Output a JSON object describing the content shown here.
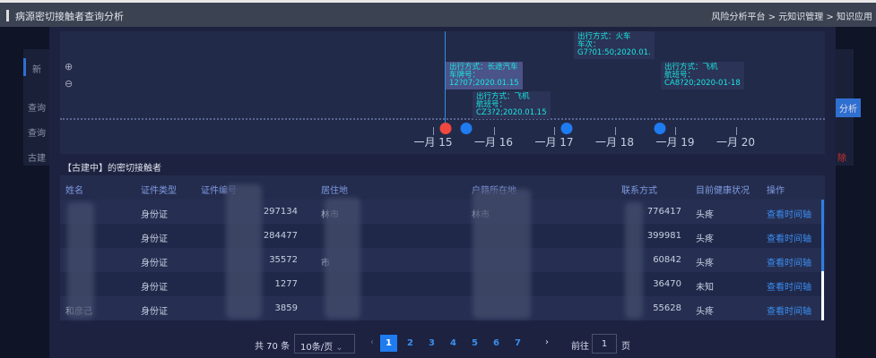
{
  "header": {
    "title": "病源密切接触者查询分析",
    "breadcrumb": "风险分析平台 > 元知识管理 > 知识应用"
  },
  "background": {
    "tab": "新",
    "query_label": "查询",
    "input_placeholder": "查询",
    "row_text": "古建",
    "analyze_button": "分析",
    "delete_text": "除"
  },
  "timeline": {
    "zoom_in": "⊕",
    "zoom_out": "⊖",
    "ticks": [
      "一月 15",
      "一月 16",
      "一月 17",
      "一月 18",
      "一月 19",
      "一月 20"
    ],
    "points": [
      {
        "color": "#f0483e",
        "day": 15.2
      },
      {
        "color": "#1e7bf0",
        "day": 15.55
      },
      {
        "color": "#1e7bf0",
        "day": 17.2
      },
      {
        "color": "#1e7bf0",
        "day": 18.75
      }
    ],
    "tooltips": [
      {
        "lines": [
          "出行方式：火车",
          "车次：",
          "G7?01:50;2020.01."
        ]
      },
      {
        "lines": [
          "出行方式：长途汽车",
          "车牌号：",
          "12?07;2020.01.15"
        ]
      },
      {
        "lines": [
          "出行方式：飞机",
          "航班号：",
          "CZ3?2;2020.01.15"
        ]
      },
      {
        "lines": [
          "出行方式：飞机",
          "航班号：",
          "CA8?20;2020-01-18"
        ]
      }
    ]
  },
  "section_title": "【古建中】的密切接触者",
  "table": {
    "headers": [
      "姓名",
      "证件类型",
      "证件编号",
      "居住地",
      "户籍所在地",
      "联系方式",
      "目前健康状况",
      "操作"
    ],
    "rows": [
      [
        "",
        "身份证",
        "297134",
        "林市",
        "林市",
        "776417",
        "头疼",
        "查看时间轴"
      ],
      [
        "",
        "身份证",
        "284477",
        "",
        "",
        "399981",
        "头疼",
        "查看时间轴"
      ],
      [
        "",
        "身份证",
        "35572",
        "市",
        "",
        "60842",
        "头疼",
        "查看时间轴"
      ],
      [
        "",
        "身份证",
        "1277",
        "",
        "",
        "36470",
        "未知",
        "查看时间轴"
      ],
      [
        "和彦己",
        "身份证",
        "3859",
        "",
        "",
        "55628",
        "头疼",
        "查看时间轴"
      ]
    ]
  },
  "pagination": {
    "total": "共 70 条",
    "page_size": "10条/页",
    "pages": [
      "1",
      "2",
      "3",
      "4",
      "5",
      "6",
      "7"
    ],
    "current": "1",
    "prev": "‹",
    "next": "›",
    "goto_label": "前往",
    "goto_value": "1",
    "page_suffix": "页"
  },
  "colors": {
    "accent": "#1e7bf0",
    "current_point": "#f0483e",
    "tooltip_text": "#19e6e0"
  }
}
